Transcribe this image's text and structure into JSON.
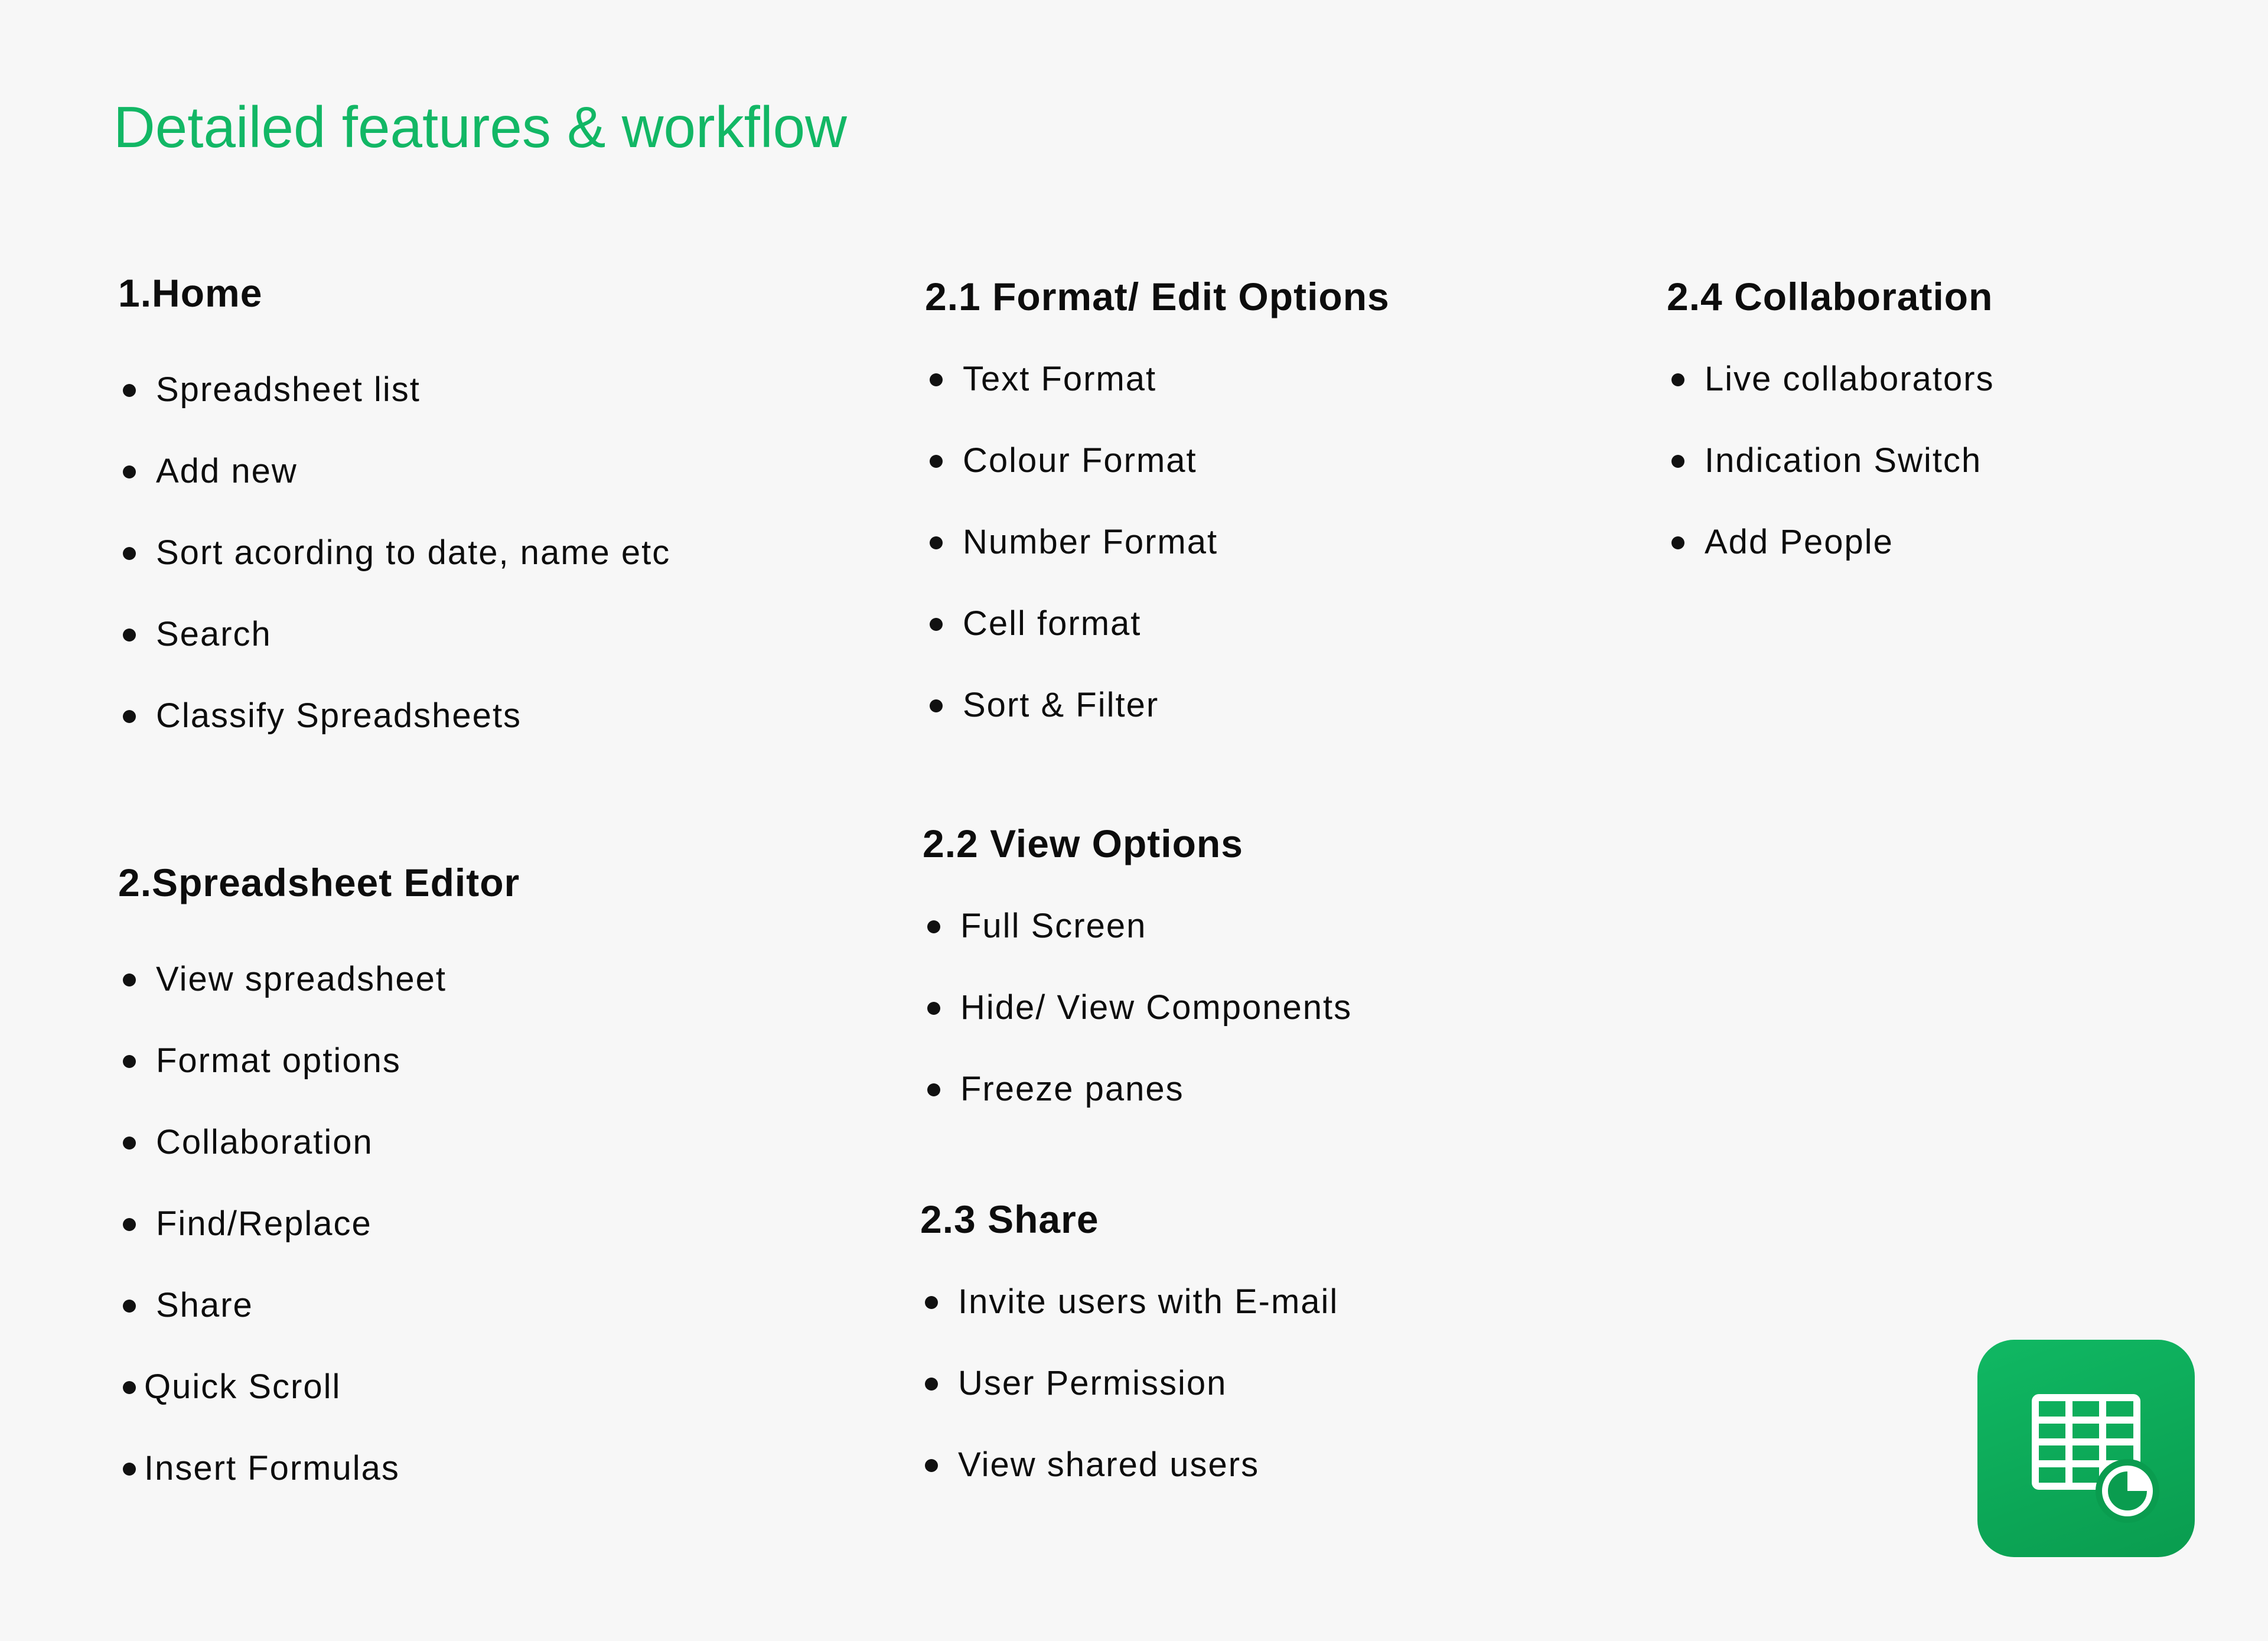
{
  "title": "Detailed features & workflow",
  "sections": {
    "home": {
      "heading": "1.Home",
      "items": [
        "Spreadsheet list",
        "Add new",
        "Sort acording to date, name etc",
        "Search",
        "Classify Spreadsheets"
      ]
    },
    "editor": {
      "heading": "2.Spreadsheet Editor",
      "items": [
        "View spreadsheet",
        "Format options",
        "Collaboration",
        "Find/Replace",
        "Share",
        "Quick Scroll",
        "Insert Formulas"
      ]
    },
    "format": {
      "heading": "2.1 Format/ Edit Options",
      "items": [
        "Text Format",
        "Colour Format",
        "Number Format",
        "Cell format",
        "Sort & Filter"
      ]
    },
    "view": {
      "heading": "2.2 View Options",
      "items": [
        "Full Screen",
        "Hide/ View Components",
        "Freeze panes"
      ]
    },
    "share": {
      "heading": "2.3 Share",
      "items": [
        "Invite users with E-mail",
        "User Permission",
        "View shared users"
      ]
    },
    "collaboration": {
      "heading": "2.4 Collaboration",
      "items": [
        "Live collaborators",
        "Indication Switch",
        "Add People"
      ]
    }
  },
  "app_icon": {
    "name": "spreadsheet-chart-icon",
    "background": "#0fb15e",
    "foreground": "#ffffff"
  },
  "colors": {
    "accent": "#12b765",
    "text": "#0d0d0d",
    "background": "#f7f7f7"
  }
}
